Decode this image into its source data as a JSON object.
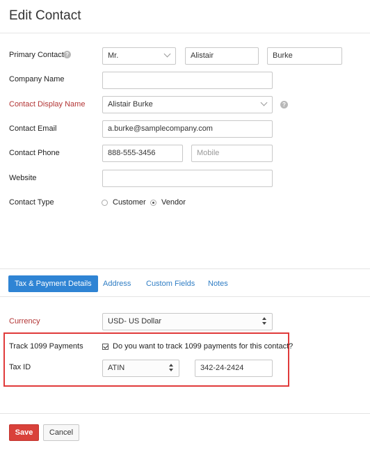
{
  "page": {
    "title": "Edit Contact"
  },
  "primary_contact": {
    "label": "Primary Contact",
    "salutation": "Mr.",
    "first_name": "Alistair",
    "last_name": "Burke"
  },
  "company_name": {
    "label": "Company Name",
    "value": ""
  },
  "display_name": {
    "label": "Contact Display Name",
    "value": "Alistair Burke"
  },
  "email": {
    "label": "Contact Email",
    "value": "a.burke@samplecompany.com"
  },
  "phone": {
    "label": "Contact Phone",
    "work": "888-555-3456",
    "mobile_placeholder": "Mobile"
  },
  "website": {
    "label": "Website",
    "value": ""
  },
  "contact_type": {
    "label": "Contact Type",
    "options": [
      "Customer",
      "Vendor"
    ],
    "selected": "Vendor"
  },
  "tabs": [
    {
      "label": "Tax & Payment Details",
      "active": true
    },
    {
      "label": "Address",
      "active": false
    },
    {
      "label": "Custom Fields",
      "active": false
    },
    {
      "label": "Notes",
      "active": false
    }
  ],
  "currency": {
    "label": "Currency",
    "value": "USD- US Dollar"
  },
  "track_1099": {
    "label": "Track 1099 Payments",
    "checkbox_label": "Do you want to track 1099 payments for this contact?",
    "checked": true
  },
  "tax_id": {
    "label": "Tax ID",
    "type": "ATIN",
    "value": "342-24-2424"
  },
  "actions": {
    "save": "Save",
    "cancel": "Cancel"
  },
  "colors": {
    "accent": "#2f84d4",
    "required_label": "#b23434",
    "save_button": "#d9413a",
    "highlight": "#e03a3a"
  }
}
